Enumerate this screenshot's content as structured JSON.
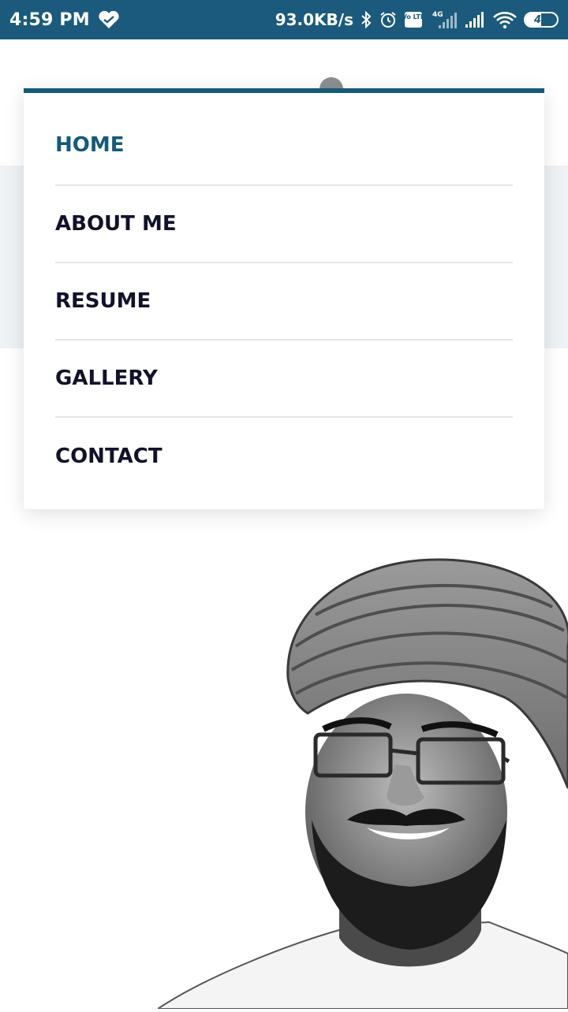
{
  "status_bar": {
    "time": "4:59 PM",
    "net_speed": "93.0KB/s",
    "battery_level": "49",
    "battery_fraction": 0.49,
    "icons": [
      "heart-icon",
      "bluetooth-icon",
      "alarm-icon",
      "volte-icon",
      "signal-icon",
      "signal-icon",
      "wifi-icon",
      "battery-icon"
    ],
    "network_label": "4G",
    "volte_label": "Vo LTE"
  },
  "nav": {
    "items": [
      {
        "label": "HOME",
        "active": true
      },
      {
        "label": "ABOUT ME",
        "active": false
      },
      {
        "label": "RESUME",
        "active": false
      },
      {
        "label": "GALLERY",
        "active": false
      },
      {
        "label": "CONTACT",
        "active": false
      }
    ]
  },
  "colors": {
    "status_bar": "#1b5a7c",
    "accent": "#155a78",
    "menu_text": "#12122a",
    "band": "#eef2f5"
  }
}
